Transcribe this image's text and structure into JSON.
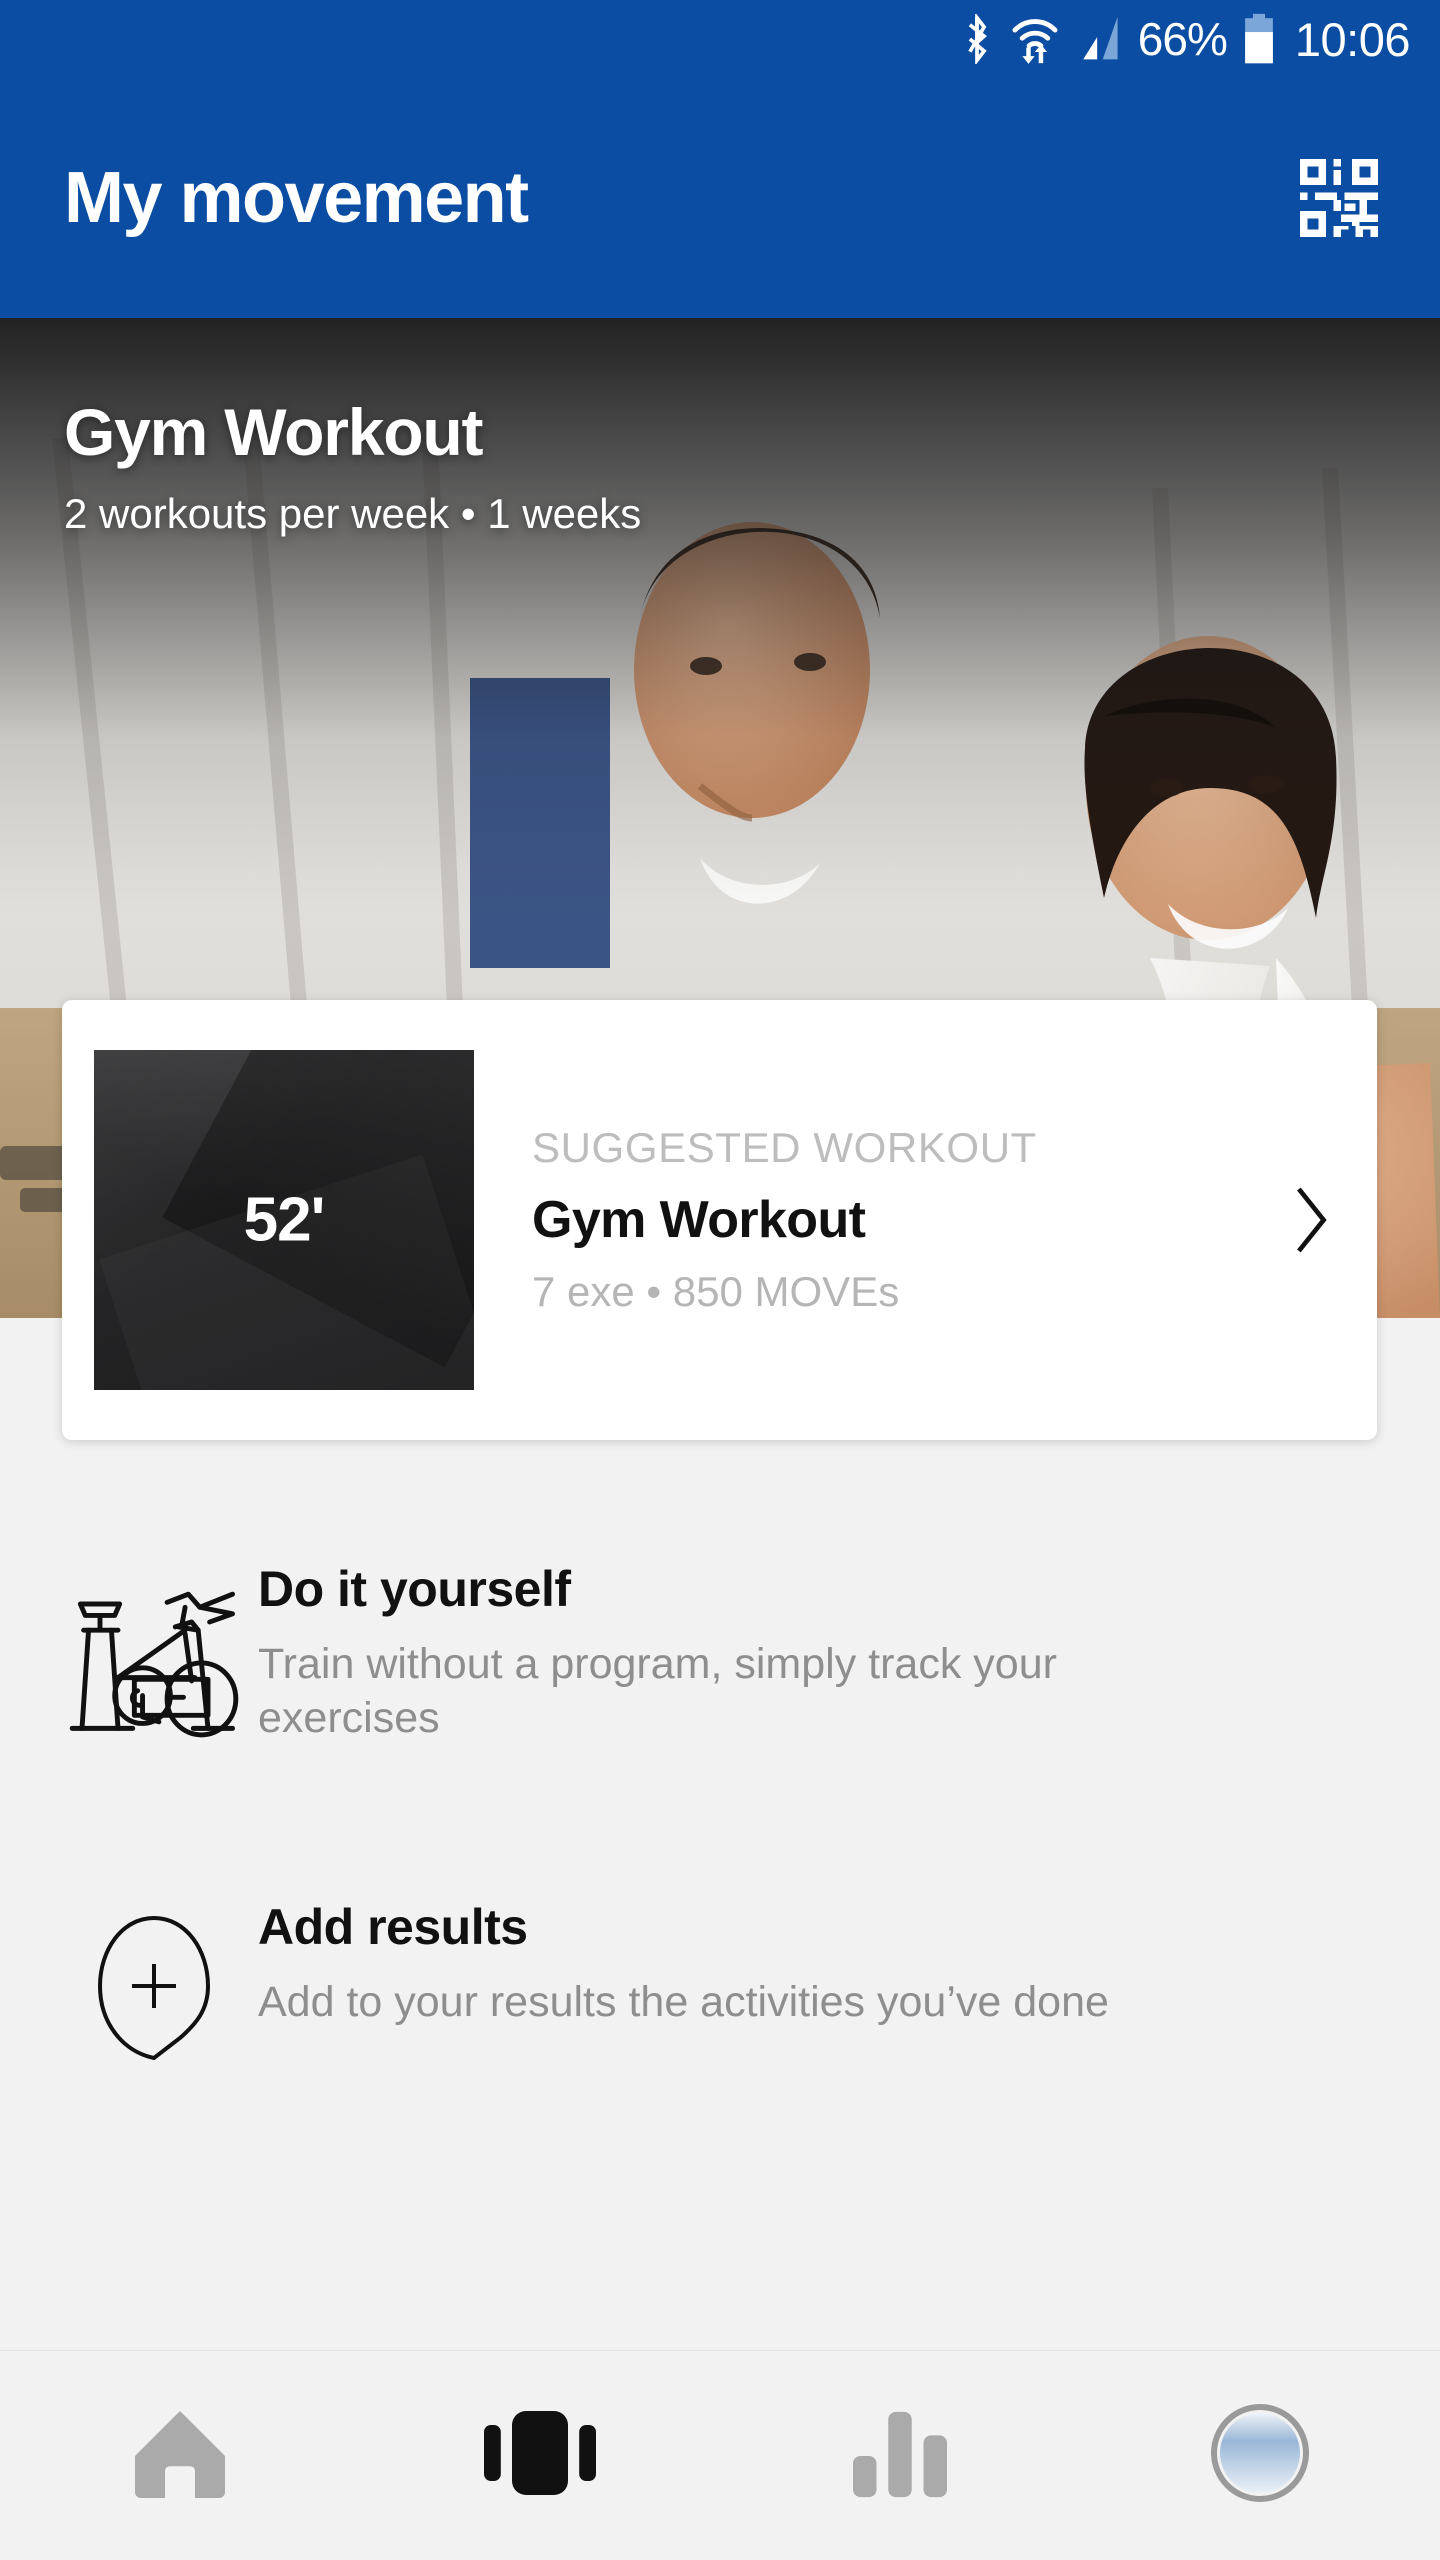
{
  "statusbar": {
    "icons": [
      "bluetooth-icon",
      "wifi-icon",
      "cellular-signal-icon",
      "battery-icon"
    ],
    "battery_percent": "66%",
    "clock": "10:06"
  },
  "appbar": {
    "title": "My movement",
    "action_icon": "qr-code-icon",
    "background_color": "#0b4da2"
  },
  "hero": {
    "title": "Gym Workout",
    "subtitle": "2 workouts per week • 1 weeks"
  },
  "suggested_card": {
    "duration": "52'",
    "kicker": "SUGGESTED WORKOUT",
    "title": "Gym Workout",
    "meta": "7 exe • 850 MOVEs",
    "chevron_icon": "chevron-right-icon"
  },
  "actions": [
    {
      "icon": "exercise-bike-icon",
      "title": "Do it yourself",
      "description": "Train without a program, simply track your exercises"
    },
    {
      "icon": "add-pin-icon",
      "title": "Add results",
      "description": "Add to your results the activities you’ve done"
    }
  ],
  "bottom_nav": {
    "items": [
      {
        "icon": "home-icon",
        "active": false
      },
      {
        "icon": "cards-carousel-icon",
        "active": true
      },
      {
        "icon": "bar-chart-icon",
        "active": false
      },
      {
        "icon": "profile-avatar-icon",
        "active": false
      }
    ],
    "active_color": "#111111",
    "inactive_color": "#aaaaaa"
  }
}
